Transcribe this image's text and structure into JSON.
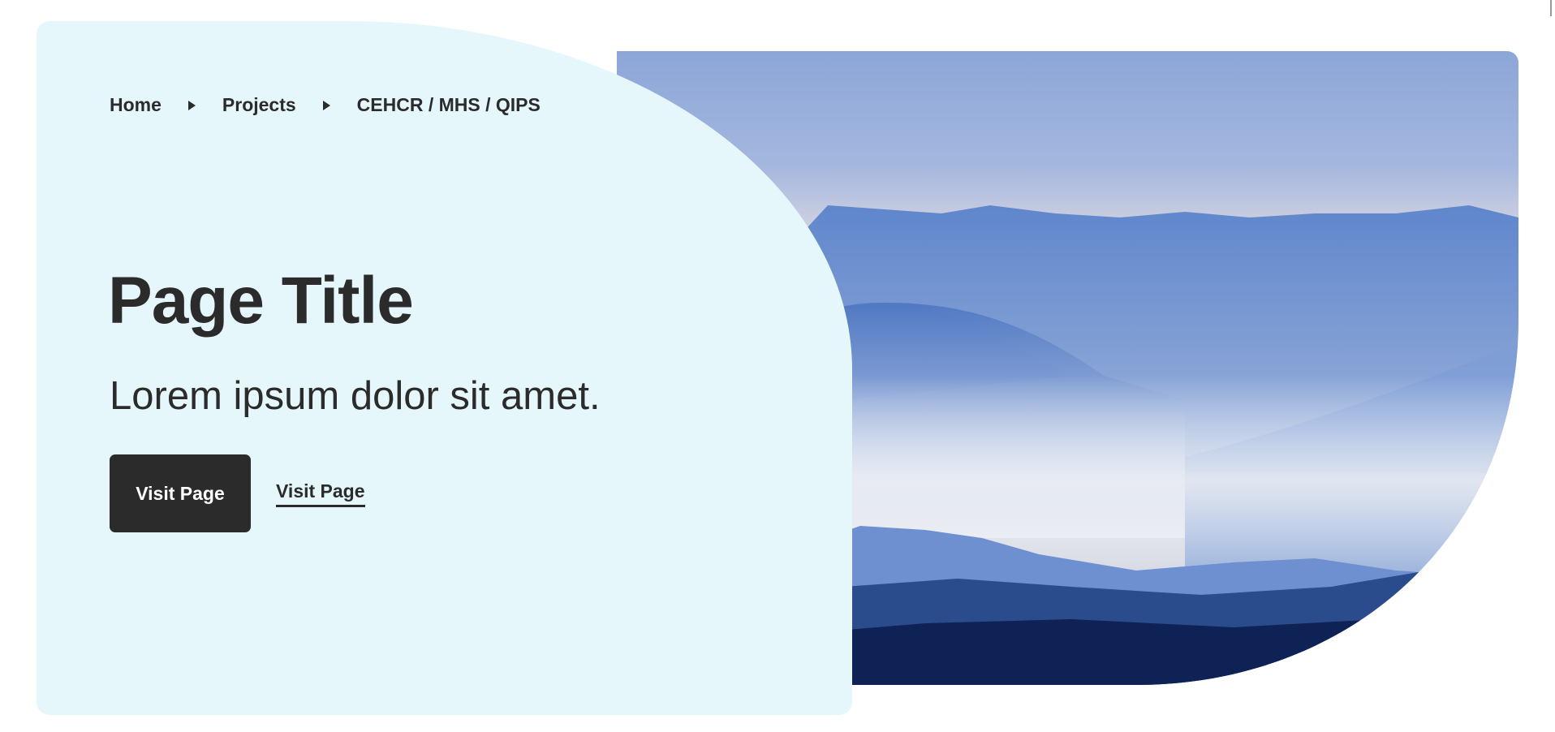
{
  "breadcrumb": {
    "items": [
      {
        "label": "Home"
      },
      {
        "label": "Projects"
      },
      {
        "label": "CEHCR / MHS / QIPS"
      }
    ]
  },
  "hero": {
    "title": "Page Title",
    "subtitle": "Lorem ipsum dolor sit amet.",
    "primary_button_label": "Visit Page",
    "link_label": "Visit Page",
    "image_icon": "mountain-landscape-image"
  },
  "colors": {
    "card_background": "#e6f7fc",
    "text": "#2b2b2b",
    "button_background": "#2b2b2b",
    "button_text": "#ffffff"
  }
}
